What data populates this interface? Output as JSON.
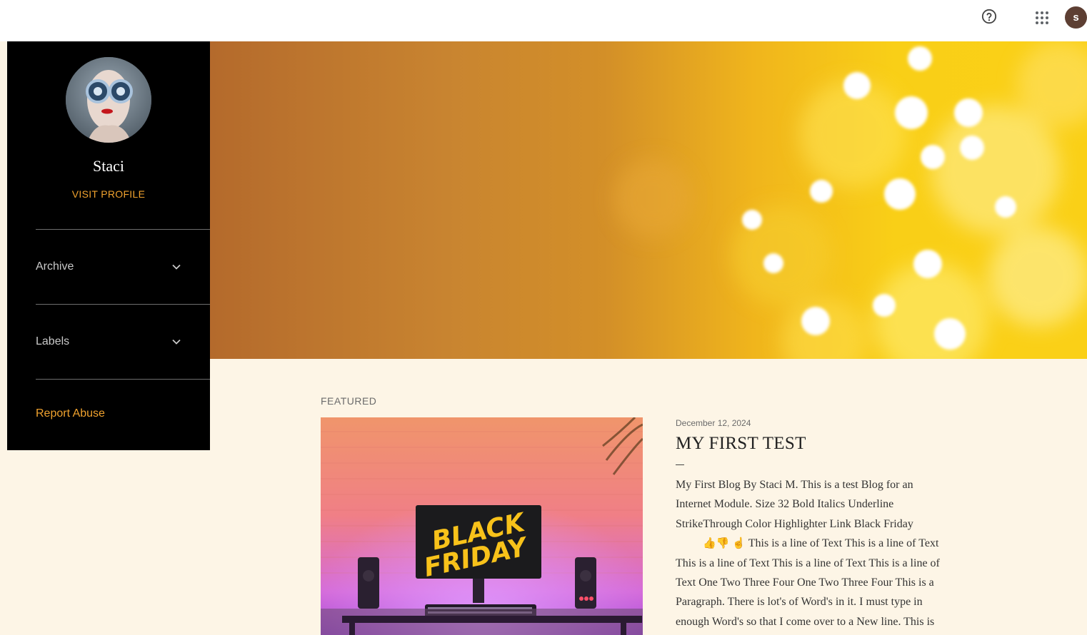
{
  "topbar": {
    "help_icon": "help-circle-icon",
    "apps_icon": "apps-grid-icon",
    "avatar_letter": "s"
  },
  "sidebar": {
    "name": "Staci",
    "visit_profile": "VISIT PROFILE",
    "items": [
      {
        "label": "Archive",
        "icon": "chevron-down-icon"
      },
      {
        "label": "Labels",
        "icon": "chevron-down-icon"
      }
    ],
    "report_abuse": "Report Abuse"
  },
  "featured": {
    "section_label": "FEATURED",
    "image_text_line1": "BLACK",
    "image_text_line2": "FRIDAY",
    "date": "December 12, 2024",
    "title": "MY FIRST TEST",
    "body_lines": [
      "My First Blog By Staci M. This is a test Blog for an",
      "Internet Module. Size 32 Bold Italics Underline",
      "StrikeThrough Color Highlighter Link Black Friday",
      "This is a line of Text This is a line of Text",
      "This is a line of Text This is a line of Text This is a line of",
      "Text One Two Three Four One Two Three Four This is a",
      "Paragraph. There is lot's of Word's in it. I must type in",
      "enough Word's so that I come over to a New line. This is"
    ],
    "emojis": [
      "👍",
      "👎",
      "☝"
    ]
  },
  "colors": {
    "accent": "#f0a22e",
    "sidebar_bg": "#000000",
    "page_bg": "#fdf5e6",
    "avatar_bg": "#5d3f33"
  }
}
